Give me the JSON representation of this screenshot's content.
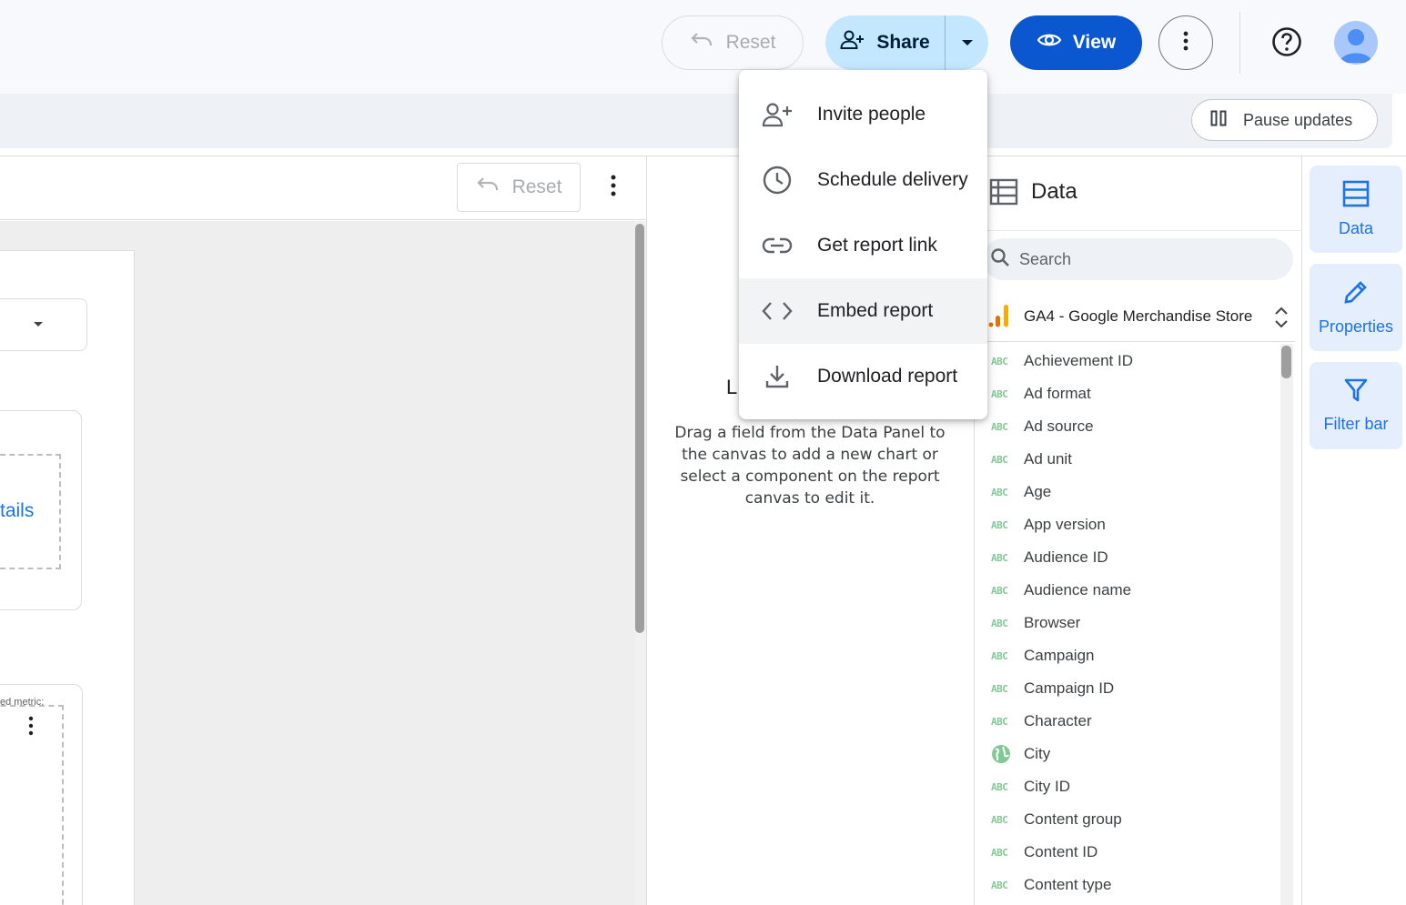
{
  "header": {
    "reset_label": "Reset",
    "share_label": "Share",
    "view_label": "View",
    "pause_label": "Pause updates"
  },
  "canvas": {
    "reset_label": "Reset",
    "details_link": "tails",
    "metric_text": "ed metric:"
  },
  "share_menu": {
    "items": [
      {
        "label": "Invite people",
        "icon": "person-add-icon"
      },
      {
        "label": "Schedule delivery",
        "icon": "clock-icon"
      },
      {
        "label": "Get report link",
        "icon": "link-icon"
      },
      {
        "label": "Embed report",
        "icon": "code-icon"
      },
      {
        "label": "Download report",
        "icon": "download-icon"
      }
    ]
  },
  "properties_panel": {
    "partial_heading": "L",
    "hint": "Drag a field from the Data Panel to the canvas to add a new chart or select a component on the report canvas to edit it."
  },
  "data_panel": {
    "title": "Data",
    "search_placeholder": "Search",
    "source_name": "GA4 - Google Merchandise Store",
    "type_label": "ABC",
    "fields": [
      {
        "name": "Achievement ID",
        "type": "text"
      },
      {
        "name": "Ad format",
        "type": "text"
      },
      {
        "name": "Ad source",
        "type": "text"
      },
      {
        "name": "Ad unit",
        "type": "text"
      },
      {
        "name": "Age",
        "type": "text"
      },
      {
        "name": "App version",
        "type": "text"
      },
      {
        "name": "Audience ID",
        "type": "text"
      },
      {
        "name": "Audience name",
        "type": "text"
      },
      {
        "name": "Browser",
        "type": "text"
      },
      {
        "name": "Campaign",
        "type": "text"
      },
      {
        "name": "Campaign ID",
        "type": "text"
      },
      {
        "name": "Character",
        "type": "text"
      },
      {
        "name": "City",
        "type": "geo"
      },
      {
        "name": "City ID",
        "type": "text"
      },
      {
        "name": "Content group",
        "type": "text"
      },
      {
        "name": "Content ID",
        "type": "text"
      },
      {
        "name": "Content type",
        "type": "text"
      }
    ]
  },
  "rail": {
    "data_label": "Data",
    "properties_label": "Properties",
    "filter_label": "Filter bar"
  },
  "colors": {
    "accent": "#0b57d0",
    "share_bg": "#c2e7ff",
    "field_type": "#81c995",
    "rail_bg": "#e5eefc"
  }
}
